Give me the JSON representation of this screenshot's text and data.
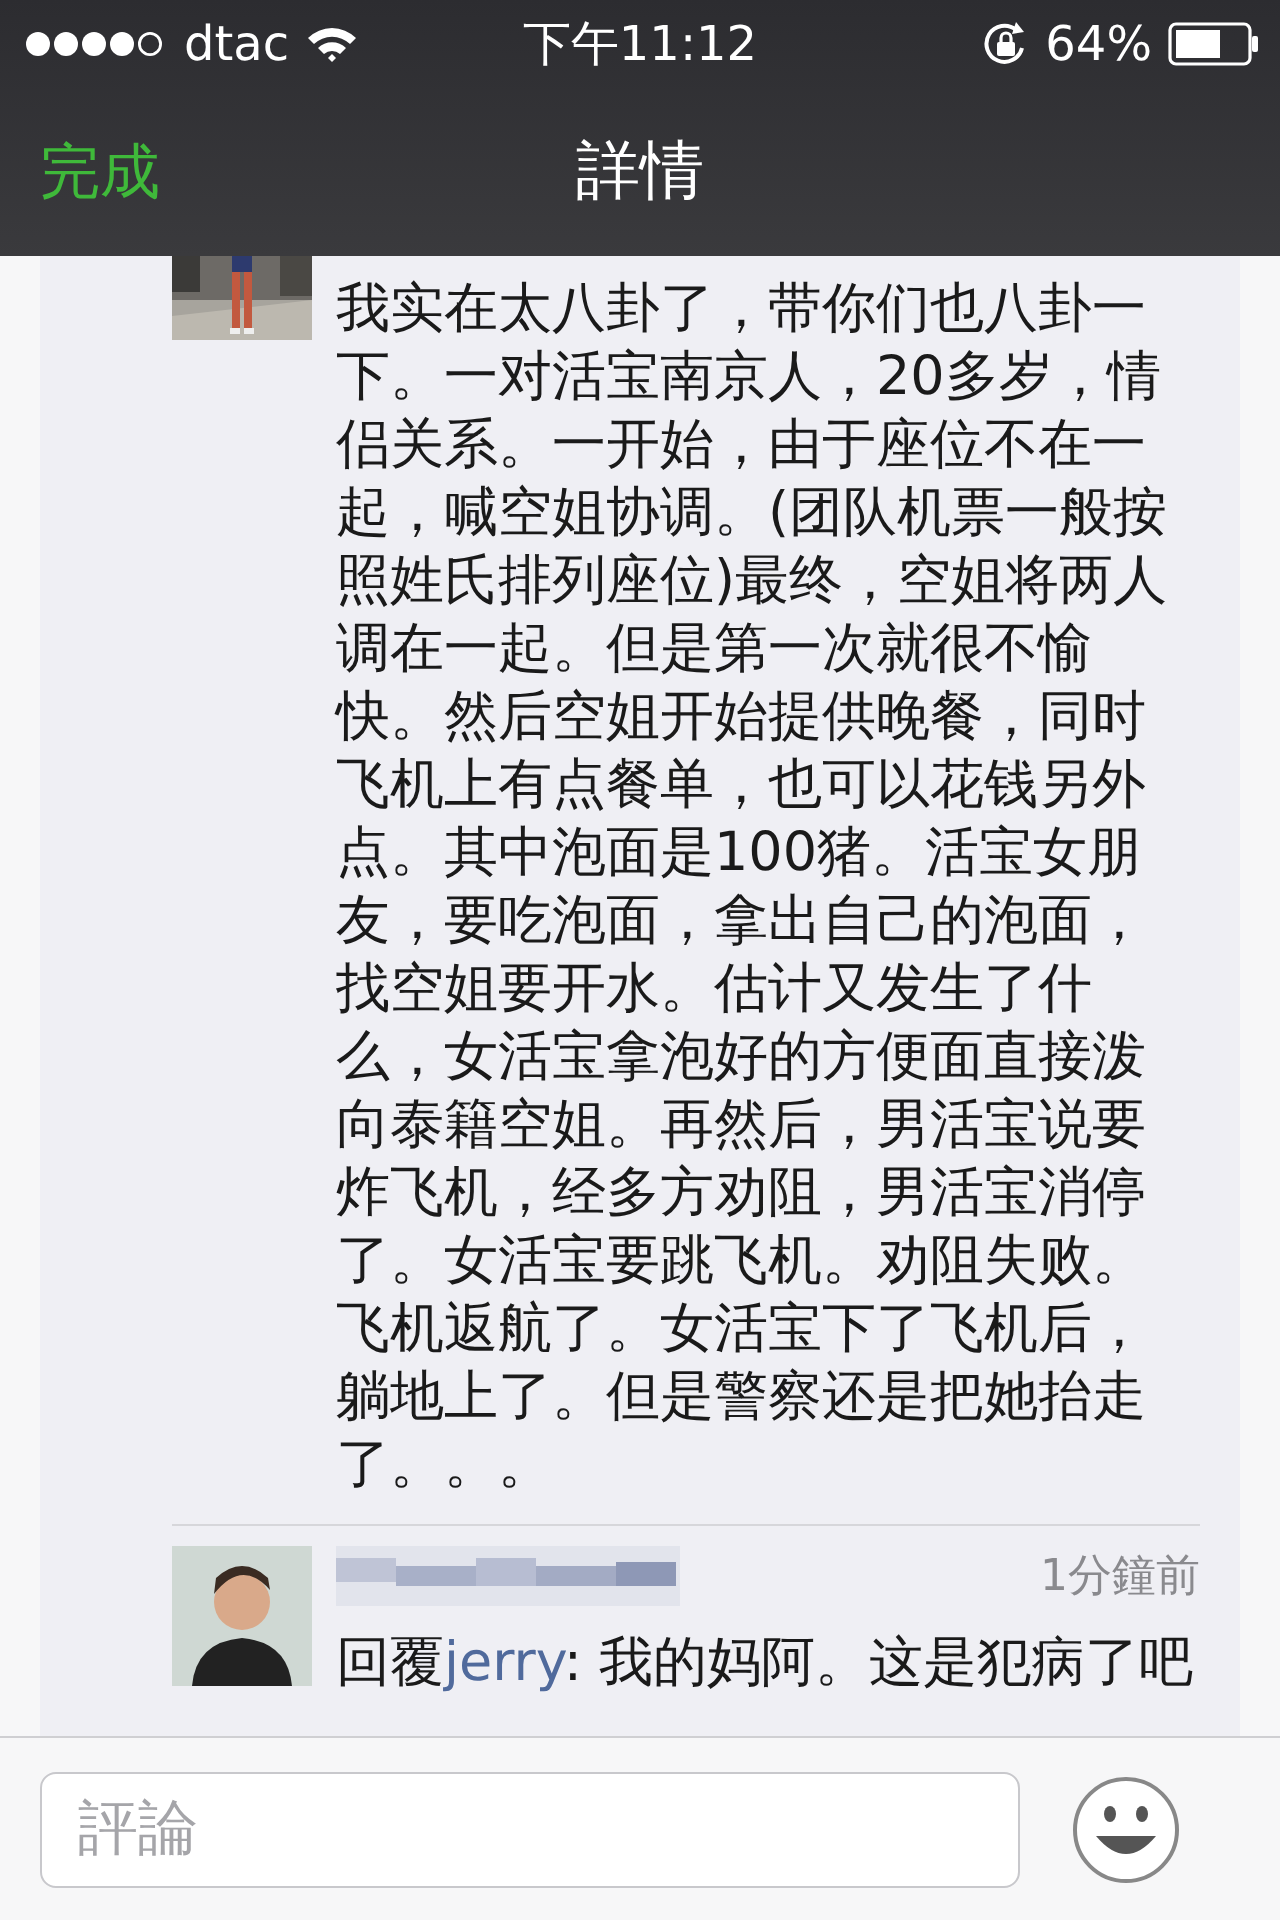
{
  "status_bar": {
    "carrier": "dtac",
    "time": "下午11:12",
    "battery": "64%"
  },
  "nav": {
    "done": "完成",
    "title": "詳情"
  },
  "post": {
    "text": "我实在太八卦了，带你们也八卦一下。一对活宝南京人，20多岁，情侣关系。一开始，由于座位不在一起，喊空姐协调。(团队机票一般按照姓氏排列座位)最终，空姐将两人调在一起。但是第一次就很不愉快。然后空姐开始提供晚餐，同时飞机上有点餐单，也可以花钱另外点。其中泡面是100猪。活宝女朋友，要吃泡面，拿出自己的泡面，找空姐要开水。估计又发生了什么，女活宝拿泡好的方便面直接泼向泰籍空姐。再然后，男活宝说要炸飞机，经多方劝阻，男活宝消停了。女活宝要跳飞机。劝阻失败。飞机返航了。女活宝下了飞机后，躺地上了。但是警察还是把她抬走了。。。"
  },
  "reply": {
    "time": "1分鐘前",
    "prefix": "回覆",
    "target": "jerry",
    "text": ": 我的妈阿。这是犯病了吧"
  },
  "composer": {
    "placeholder": "評論"
  }
}
